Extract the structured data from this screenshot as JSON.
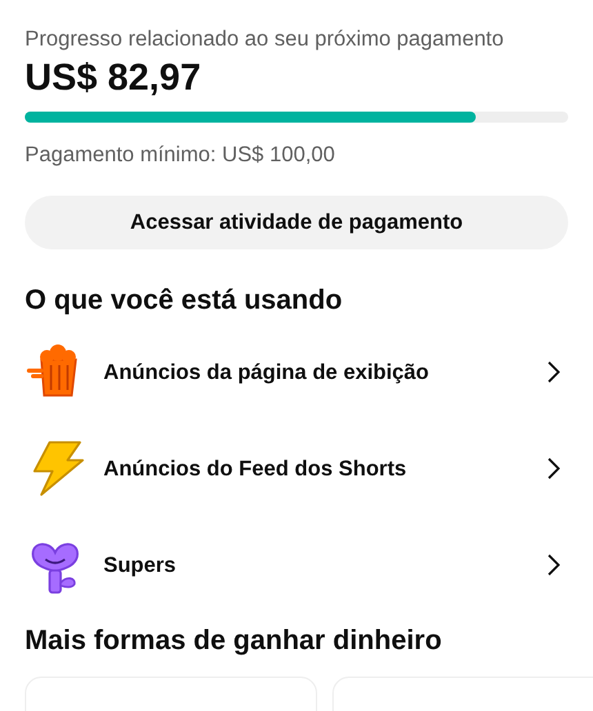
{
  "progress": {
    "caption": "Progresso relacionado ao seu próximo pagamento",
    "amount": "US$ 82,97",
    "level": 0.83,
    "minimum": "Pagamento mínimo: US$ 100,00"
  },
  "activity_button": "Acessar atividade de pagamento",
  "using_heading": "O que você está usando",
  "features": [
    {
      "kind": "popcorn",
      "label": "Anúncios da página de exibição"
    },
    {
      "kind": "bolt",
      "label": "Anúncios do Feed dos Shorts"
    },
    {
      "kind": "plant",
      "label": "Supers"
    }
  ],
  "more_heading": "Mais formas de ganhar dinheiro",
  "more_cards": [
    {
      "kind": "card"
    },
    {
      "kind": "card"
    }
  ]
}
